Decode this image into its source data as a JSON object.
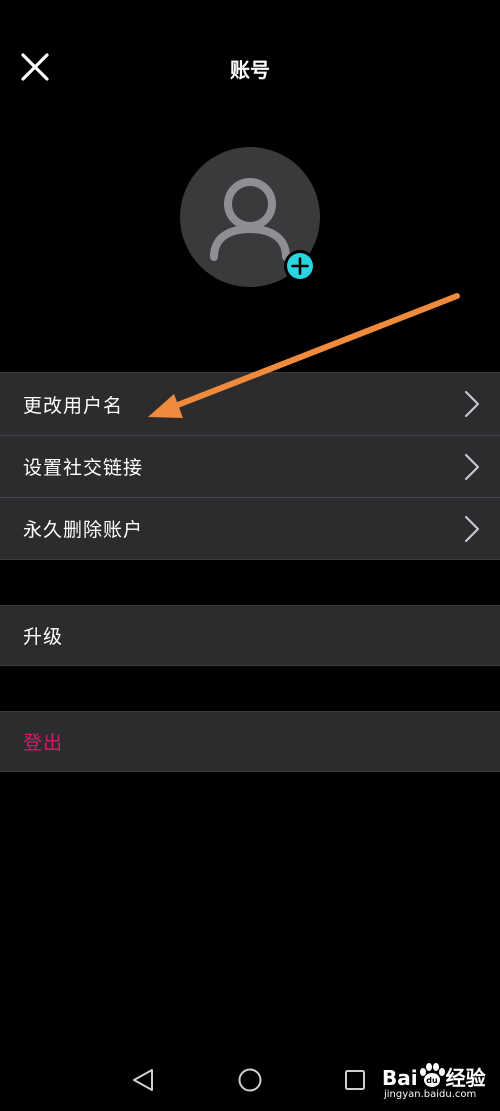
{
  "header": {
    "title": "账号",
    "close_icon": "close-icon"
  },
  "avatar": {
    "icon": "user-placeholder-icon",
    "add_icon": "plus-circle-icon",
    "add_color": "#2ad4e0"
  },
  "groups": {
    "account_items": [
      {
        "label": "更改用户名"
      },
      {
        "label": "设置社交链接"
      },
      {
        "label": "永久删除账户"
      }
    ],
    "upgrade_label": "升级",
    "logout_label": "登出"
  },
  "colors": {
    "background": "#000000",
    "row_background": "#2c2c2e",
    "danger": "#e0176a",
    "annotation_arrow": "#f08a3c"
  },
  "navbar": {
    "back_icon": "back-triangle-icon",
    "home_icon": "home-circle-icon",
    "recent_icon": "recent-square-icon"
  },
  "watermark": {
    "brand": "Bai",
    "brand_suffix": "经验",
    "domain": "jingyan.baidu.com"
  }
}
